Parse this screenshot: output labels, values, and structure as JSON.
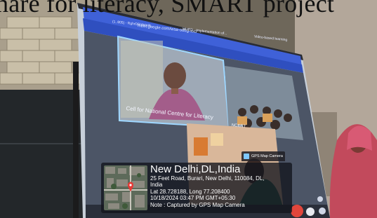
{
  "heading": {
    "text": "hare for literacy, SMART project"
  },
  "browser": {
    "tabs": [
      {
        "label": "(1, 805) - RghrDB/details..."
      },
      {
        "label": "MHRD - Implementation of..."
      },
      {
        "label": "Video-based learning"
      }
    ],
    "address": "meet.google.com/wsa-odbg-sxd"
  },
  "meeting": {
    "tile_main_caption": "Cell for National Centre for Literacy",
    "tile_right_caption": "NCERT",
    "controls": [
      "end-call-icon",
      "mic-icon",
      "people-icon",
      "camera-icon"
    ]
  },
  "gps": {
    "badge": "GPS Map Camera",
    "title": "New Delhi,DL,India",
    "lines": [
      "25 Feet Road, Burari, New Delhi, 110084, DL,",
      "India",
      "Lat 28.728188, Long 77.208400",
      "10/18/2024 03:47 PM GMT+05:30",
      "Note : Captured by GPS Map Camera"
    ]
  },
  "colors": {
    "screen_frame": "#1c1d22",
    "browser_bar": "#3f61d8",
    "end_call": "#e2463c",
    "card_bg": "#12141c"
  }
}
